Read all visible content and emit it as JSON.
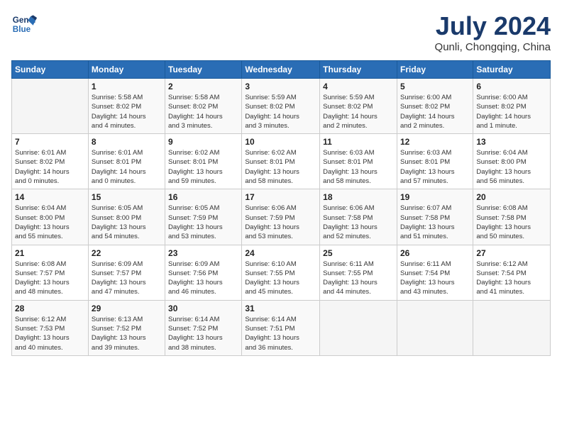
{
  "header": {
    "logo_line1": "General",
    "logo_line2": "Blue",
    "month_title": "July 2024",
    "location": "Qunli, Chongqing, China"
  },
  "weekdays": [
    "Sunday",
    "Monday",
    "Tuesday",
    "Wednesday",
    "Thursday",
    "Friday",
    "Saturday"
  ],
  "weeks": [
    [
      {
        "day": "",
        "info": ""
      },
      {
        "day": "1",
        "info": "Sunrise: 5:58 AM\nSunset: 8:02 PM\nDaylight: 14 hours\nand 4 minutes."
      },
      {
        "day": "2",
        "info": "Sunrise: 5:58 AM\nSunset: 8:02 PM\nDaylight: 14 hours\nand 3 minutes."
      },
      {
        "day": "3",
        "info": "Sunrise: 5:59 AM\nSunset: 8:02 PM\nDaylight: 14 hours\nand 3 minutes."
      },
      {
        "day": "4",
        "info": "Sunrise: 5:59 AM\nSunset: 8:02 PM\nDaylight: 14 hours\nand 2 minutes."
      },
      {
        "day": "5",
        "info": "Sunrise: 6:00 AM\nSunset: 8:02 PM\nDaylight: 14 hours\nand 2 minutes."
      },
      {
        "day": "6",
        "info": "Sunrise: 6:00 AM\nSunset: 8:02 PM\nDaylight: 14 hours\nand 1 minute."
      }
    ],
    [
      {
        "day": "7",
        "info": "Sunrise: 6:01 AM\nSunset: 8:02 PM\nDaylight: 14 hours\nand 0 minutes."
      },
      {
        "day": "8",
        "info": "Sunrise: 6:01 AM\nSunset: 8:01 PM\nDaylight: 14 hours\nand 0 minutes."
      },
      {
        "day": "9",
        "info": "Sunrise: 6:02 AM\nSunset: 8:01 PM\nDaylight: 13 hours\nand 59 minutes."
      },
      {
        "day": "10",
        "info": "Sunrise: 6:02 AM\nSunset: 8:01 PM\nDaylight: 13 hours\nand 58 minutes."
      },
      {
        "day": "11",
        "info": "Sunrise: 6:03 AM\nSunset: 8:01 PM\nDaylight: 13 hours\nand 58 minutes."
      },
      {
        "day": "12",
        "info": "Sunrise: 6:03 AM\nSunset: 8:01 PM\nDaylight: 13 hours\nand 57 minutes."
      },
      {
        "day": "13",
        "info": "Sunrise: 6:04 AM\nSunset: 8:00 PM\nDaylight: 13 hours\nand 56 minutes."
      }
    ],
    [
      {
        "day": "14",
        "info": "Sunrise: 6:04 AM\nSunset: 8:00 PM\nDaylight: 13 hours\nand 55 minutes."
      },
      {
        "day": "15",
        "info": "Sunrise: 6:05 AM\nSunset: 8:00 PM\nDaylight: 13 hours\nand 54 minutes."
      },
      {
        "day": "16",
        "info": "Sunrise: 6:05 AM\nSunset: 7:59 PM\nDaylight: 13 hours\nand 53 minutes."
      },
      {
        "day": "17",
        "info": "Sunrise: 6:06 AM\nSunset: 7:59 PM\nDaylight: 13 hours\nand 53 minutes."
      },
      {
        "day": "18",
        "info": "Sunrise: 6:06 AM\nSunset: 7:58 PM\nDaylight: 13 hours\nand 52 minutes."
      },
      {
        "day": "19",
        "info": "Sunrise: 6:07 AM\nSunset: 7:58 PM\nDaylight: 13 hours\nand 51 minutes."
      },
      {
        "day": "20",
        "info": "Sunrise: 6:08 AM\nSunset: 7:58 PM\nDaylight: 13 hours\nand 50 minutes."
      }
    ],
    [
      {
        "day": "21",
        "info": "Sunrise: 6:08 AM\nSunset: 7:57 PM\nDaylight: 13 hours\nand 48 minutes."
      },
      {
        "day": "22",
        "info": "Sunrise: 6:09 AM\nSunset: 7:57 PM\nDaylight: 13 hours\nand 47 minutes."
      },
      {
        "day": "23",
        "info": "Sunrise: 6:09 AM\nSunset: 7:56 PM\nDaylight: 13 hours\nand 46 minutes."
      },
      {
        "day": "24",
        "info": "Sunrise: 6:10 AM\nSunset: 7:55 PM\nDaylight: 13 hours\nand 45 minutes."
      },
      {
        "day": "25",
        "info": "Sunrise: 6:11 AM\nSunset: 7:55 PM\nDaylight: 13 hours\nand 44 minutes."
      },
      {
        "day": "26",
        "info": "Sunrise: 6:11 AM\nSunset: 7:54 PM\nDaylight: 13 hours\nand 43 minutes."
      },
      {
        "day": "27",
        "info": "Sunrise: 6:12 AM\nSunset: 7:54 PM\nDaylight: 13 hours\nand 41 minutes."
      }
    ],
    [
      {
        "day": "28",
        "info": "Sunrise: 6:12 AM\nSunset: 7:53 PM\nDaylight: 13 hours\nand 40 minutes."
      },
      {
        "day": "29",
        "info": "Sunrise: 6:13 AM\nSunset: 7:52 PM\nDaylight: 13 hours\nand 39 minutes."
      },
      {
        "day": "30",
        "info": "Sunrise: 6:14 AM\nSunset: 7:52 PM\nDaylight: 13 hours\nand 38 minutes."
      },
      {
        "day": "31",
        "info": "Sunrise: 6:14 AM\nSunset: 7:51 PM\nDaylight: 13 hours\nand 36 minutes."
      },
      {
        "day": "",
        "info": ""
      },
      {
        "day": "",
        "info": ""
      },
      {
        "day": "",
        "info": ""
      }
    ]
  ]
}
